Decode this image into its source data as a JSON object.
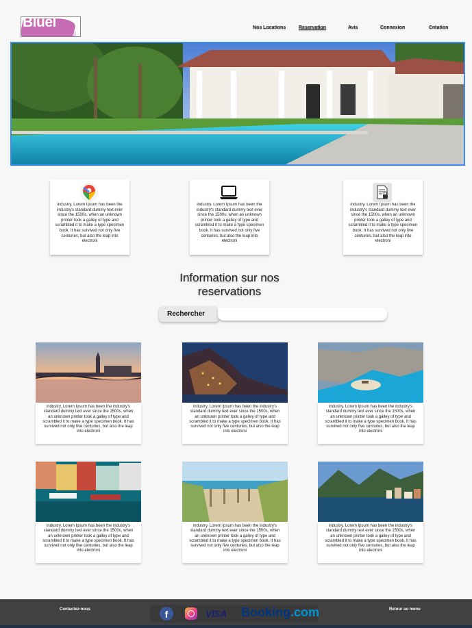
{
  "brand": {
    "logo_text": "Bluel",
    "logo_sub": "ci"
  },
  "nav": {
    "items": [
      {
        "label": "Nos Locations"
      },
      {
        "label": "Reservation"
      },
      {
        "label": "Avis"
      },
      {
        "label": "Connexion"
      },
      {
        "label": "Création"
      }
    ]
  },
  "features": [
    {
      "icon": "map-pin-icon",
      "text": "industry. Lorem Ipsum has been the industry's standard dummy text ever since the 1500s, when an unknown printer took a galley of type and scrambled it to make a type specimen book. It has survived not only five centuries, but also the leap into electroni"
    },
    {
      "icon": "laptop-icon",
      "text": "industry. Lorem Ipsum has been the industry's standard dummy text ever since the 1500s, when an unknown printer took a galley of type and scrambled it to make a type specimen book. It has survived not only five centuries, but also the leap into electroni"
    },
    {
      "icon": "document-lock-icon",
      "text": "industry. Lorem Ipsum has been the industry's standard dummy text ever since the 1500s, when an unknown printer took a galley of type and scrambled it to make a type specimen book. It has survived not only five centuries, but also the leap into electroni"
    }
  ],
  "section": {
    "title": "Information sur nos reservations"
  },
  "search": {
    "button_label": "Rechercher",
    "placeholder": ""
  },
  "destinations": [
    {
      "text": "industry. Lorem Ipsum has been the industry's standard dummy text ever since the 1500s, when an unknown printer took a galley of type and scrambled it to make a type specimen book. It has survived not only five centuries, but also the leap into electroni"
    },
    {
      "text": "industry. Lorem Ipsum has been the industry's standard dummy text ever since the 1500s, when an unknown printer took a galley of type and scrambled it to make a type specimen book. It has survived not only five centuries, but also the leap into electroni"
    },
    {
      "text": "industry. Lorem Ipsum has been the industry's standard dummy text ever since the 1500s, when an unknown printer took a galley of type and scrambled it to make a type specimen book. It has survived not only five centuries, but also the leap into electroni"
    },
    {
      "text": "industry. Lorem Ipsum has been the industry's standard dummy text ever since the 1500s, when an unknown printer took a galley of type and scrambled it to make a type specimen book. It has survived not only five centuries, but also the leap into electroni"
    },
    {
      "text": "industry. Lorem Ipsum has been the industry's standard dummy text ever since the 1500s, when an unknown printer took a galley of type and scrambled it to make a type specimen book. It has survived not only five centuries, but also the leap into electroni"
    },
    {
      "text": "industry. Lorem Ipsum has been the industry's standard dummy text ever since the 1500s, when an unknown printer took a galley of type and scrambled it to make a type specimen book. It has survived not only five centuries, but also the leap into electroni"
    }
  ],
  "footer": {
    "contact_label": "Contactez-nous",
    "back_label": "Retour au menu",
    "facebook_glyph": "f",
    "visa_label": "VISA",
    "booking_main": "Booking",
    "booking_tld": ".com"
  }
}
